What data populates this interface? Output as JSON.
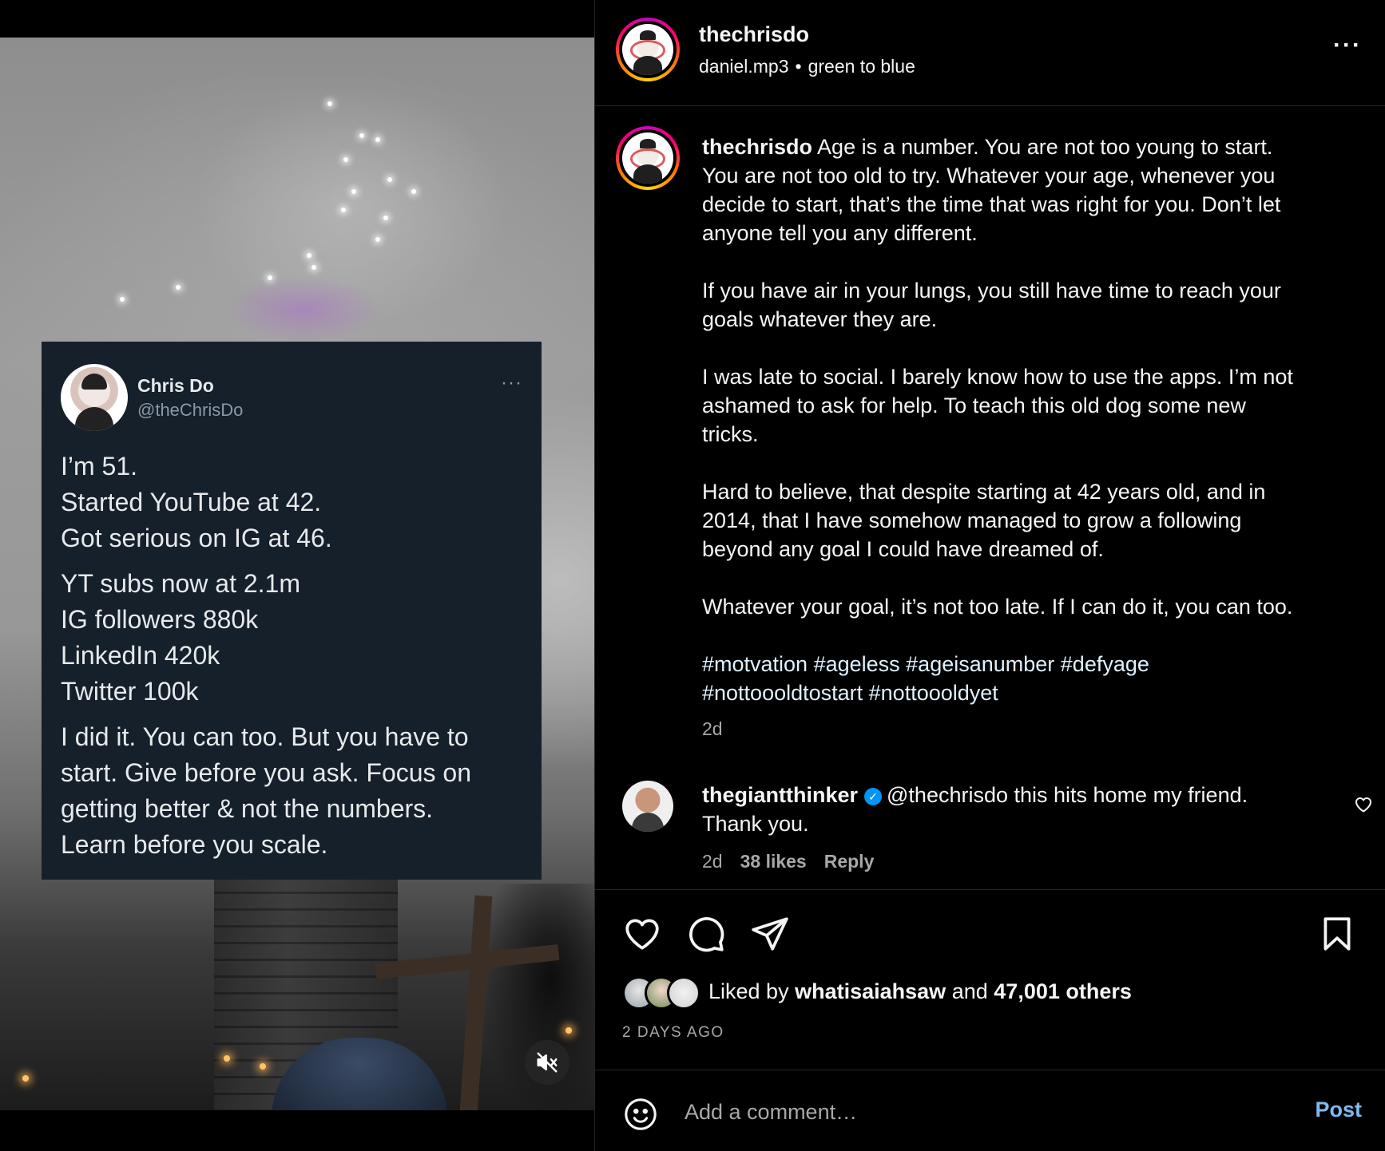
{
  "video": {
    "tweet": {
      "name": "Chris Do",
      "handle": "@theChrisDo",
      "more": "···",
      "block1": [
        "I’m 51.",
        "Started YouTube at 42.",
        "Got serious on IG at 46."
      ],
      "block2": [
        "YT subs now at 2.1m",
        "IG followers 880k",
        "LinkedIn 420k",
        "Twitter 100k"
      ],
      "block3": [
        "I did it. You can too. But you have to",
        "start. Give before you ask. Focus on",
        "getting better & not the numbers.",
        "Learn before you scale."
      ]
    },
    "mute_icon": "muted-speaker-icon"
  },
  "header": {
    "username": "thechrisdo",
    "audio": "daniel.mp3",
    "separator": "•",
    "audio_artist": "green to blue",
    "more": "···"
  },
  "caption": {
    "username": "thechrisdo",
    "first_line_rest": "Age is a number. You are not too young to start.",
    "p1_lines": [
      "You are not too old to try. Whatever your age, whenever you",
      "decide to start, that’s the time that was right for you. Don’t let",
      "anyone tell you any different."
    ],
    "p2_lines": [
      "If you have air in your lungs, you still have time to reach your",
      "goals whatever they are."
    ],
    "p3_lines": [
      "I was late to social. I barely know how to use the apps. I’m not",
      "ashamed to ask for help. To teach this old dog some new",
      "tricks."
    ],
    "p4_lines": [
      "Hard to believe, that despite starting at 42 years old, and in",
      "2014, that I have somehow managed to grow a following",
      "beyond any goal I could have dreamed of."
    ],
    "p5_lines": [
      "Whatever your goal, it’s not too late. If I can do it, you can too."
    ],
    "tag_lines": [
      "#motvation #ageless #ageisanumber #defyage",
      "#nottoooldtostart #nottoooldyet"
    ],
    "time": "2d"
  },
  "comment": {
    "username": "thegiantthinker",
    "verified_icon": "✓",
    "line1": "@thechrisdo this hits home my friend.",
    "line2": "Thank you.",
    "time": "2d",
    "likes": "38 likes",
    "reply": "Reply"
  },
  "actions": {
    "liked_by_prefix": "Liked by",
    "liked_by_user": "whatisaiahsaw",
    "and": "and",
    "others": "47,001 others",
    "date": "2 DAYS AGO"
  },
  "add_comment": {
    "placeholder": "Add a comment…",
    "post": "Post"
  },
  "colors": {
    "background": "#000000",
    "tweet_bg": "#15202b",
    "divider": "#262626",
    "post_button": "#7fbaf2",
    "verified": "#0095f6"
  }
}
